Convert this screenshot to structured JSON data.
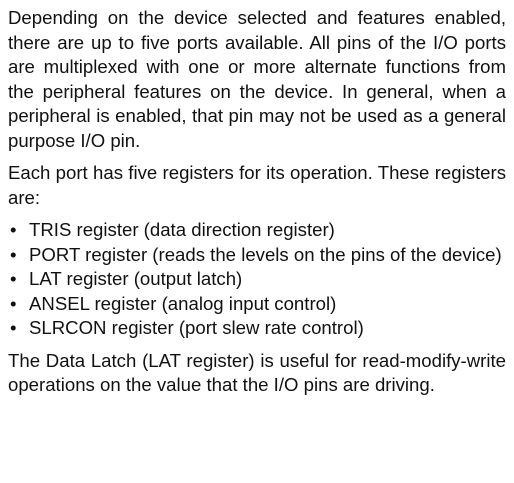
{
  "paragraphs": [
    "Depending on the device selected and features enabled, there are up to five ports available. All pins of the I/O ports are multiplexed with one or more alternate functions from the peripheral features on the device. In general, when a peripheral is enabled, that pin may not be used as a general purpose I/O pin.",
    "Each port has five registers for its operation. These registers are:"
  ],
  "bullets": [
    "TRIS register (data direction register)",
    "PORT register (reads the levels on the pins of the device)",
    "LAT register (output latch)",
    "ANSEL register (analog input control)",
    "SLRCON register (port slew rate control)"
  ],
  "closing": "The Data Latch (LAT register) is useful for read-modify-write operations on the value that the I/O pins are driving."
}
